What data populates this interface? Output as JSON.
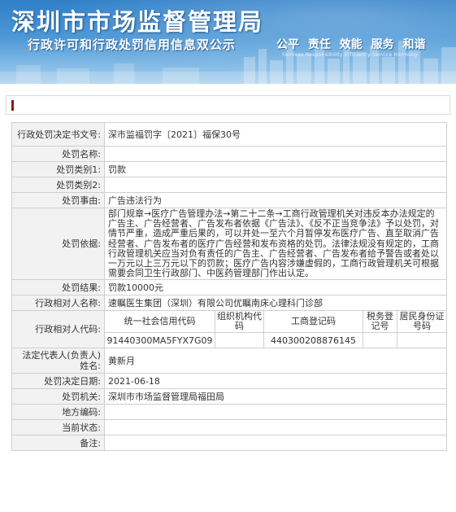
{
  "banner": {
    "title": "深圳市市场监督管理局",
    "subtitle": "行政许可和行政处罚信用信息双公示",
    "slogan": "公平 责任 效能 服务 和谐",
    "slogan_en": "Fairness  Responsibility  Efficiency  Service  Harmony"
  },
  "rows": {
    "decision_no": {
      "label": "行政处罚决定书文号:",
      "value": "深市监福罚字〔2021〕福保30号"
    },
    "name": {
      "label": "处罚名称:",
      "value": ""
    },
    "category1": {
      "label": "处罚类别1:",
      "value": "罚款"
    },
    "category2": {
      "label": "处罚类别2:",
      "value": ""
    },
    "reason": {
      "label": "处罚事由:",
      "value": "广告违法行为"
    },
    "basis": {
      "label": "处罚依据:",
      "value": "部门规章→医疗广告管理办法→第二十二条→工商行政管理机关对违反本办法规定的广告主、广告经营者、广告发布者依据《广告法》、《反不正当竞争法》予以处罚，对情节严重，造成严重后果的，可以并处一至六个月暂停发布医疗广告、直至取消广告经营者、广告发布者的医疗广告经营和发布资格的处罚。法律法规没有规定的，工商行政管理机关应当对负有责任的广告主、广告经营者、广告发布者给予警告或者处以一万元以上三万元以下的罚款；医疗广告内容涉嫌虚假的，工商行政管理机关可根据需要会同卫生行政部门、中医药管理部门作出认定。"
    },
    "result": {
      "label": "处罚结果:",
      "value": "罚款10000元"
    },
    "party_name": {
      "label": "行政相对人名称:",
      "value": "速瞩医生集团（深圳）有限公司优瞩南床心理科门诊部"
    },
    "party_code": {
      "label": "行政相对人代码:",
      "headers": [
        "统一社会信用代码",
        "组织机构代码",
        "工商登记码",
        "税务登记号",
        "居民身份证号码"
      ],
      "values": [
        "91440300MA5FYX7G09",
        "",
        "440300208876145",
        "",
        ""
      ]
    },
    "legal_rep": {
      "label": "法定代表人(负责人)姓名:",
      "value": "黄新月"
    },
    "decision_date": {
      "label": "处罚决定日期:",
      "value": "2021-06-18"
    },
    "authority": {
      "label": "处罚机关:",
      "value": "深圳市市场监督管理局福田局"
    },
    "area_code": {
      "label": "地方编码:",
      "value": ""
    },
    "status": {
      "label": "当前状态:",
      "value": ""
    },
    "remarks": {
      "label": "备注:",
      "value": ""
    }
  }
}
